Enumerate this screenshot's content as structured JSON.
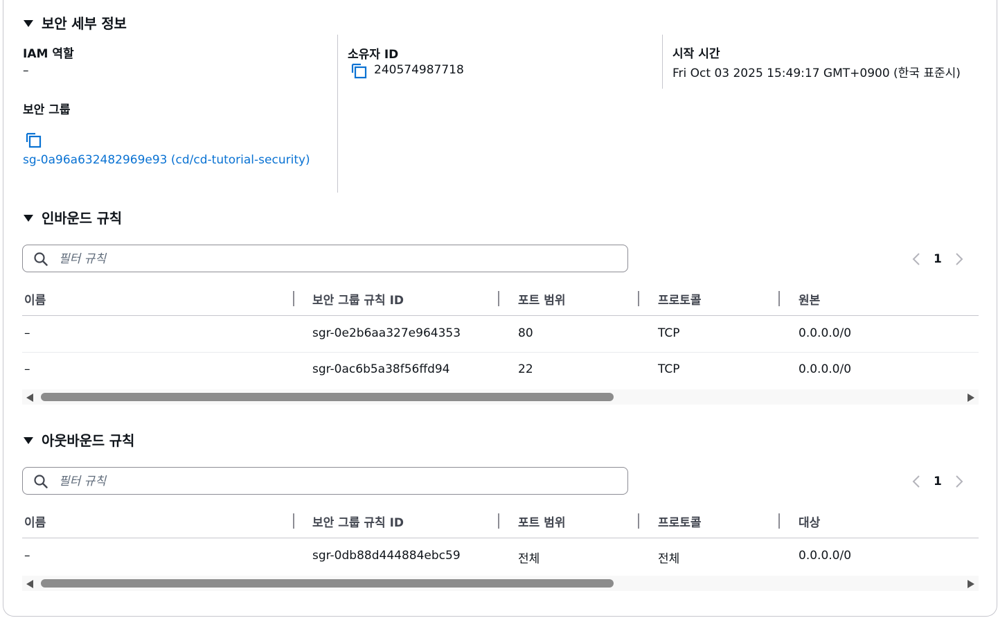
{
  "details": {
    "title": "보안 세부 정보",
    "iam_role_label": "IAM 역할",
    "iam_role_value": "–",
    "owner_id_label": "소유자 ID",
    "owner_id_value": "240574987718",
    "launch_time_label": "시작 시간",
    "launch_time_value": "Fri Oct 03 2025 15:49:17 GMT+0900 (한국 표준시)",
    "security_groups_label": "보안 그룹",
    "security_group_link": "sg-0a96a632482969e93 (cd/cd-tutorial-security)"
  },
  "inbound": {
    "title": "인바운드 규칙",
    "filter_placeholder": "필터 규칙",
    "page": "1",
    "columns": [
      "이름",
      "보안 그룹 규칙 ID",
      "포트 범위",
      "프로토콜",
      "원본"
    ],
    "rows": [
      [
        "–",
        "sgr-0e2b6aa327e964353",
        "80",
        "TCP",
        "0.0.0.0/0"
      ],
      [
        "–",
        "sgr-0ac6b5a38f56ffd94",
        "22",
        "TCP",
        "0.0.0.0/0"
      ]
    ]
  },
  "outbound": {
    "title": "아웃바운드 규칙",
    "filter_placeholder": "필터 규칙",
    "page": "1",
    "columns": [
      "이름",
      "보안 그룹 규칙 ID",
      "포트 범위",
      "프로토콜",
      "대상"
    ],
    "rows": [
      [
        "–",
        "sgr-0db88d444884ebc59",
        "전체",
        "전체",
        "0.0.0.0/0"
      ]
    ]
  },
  "colors": {
    "link": "#0972d3",
    "text": "#0f141a",
    "border": "#c6c6cd"
  }
}
